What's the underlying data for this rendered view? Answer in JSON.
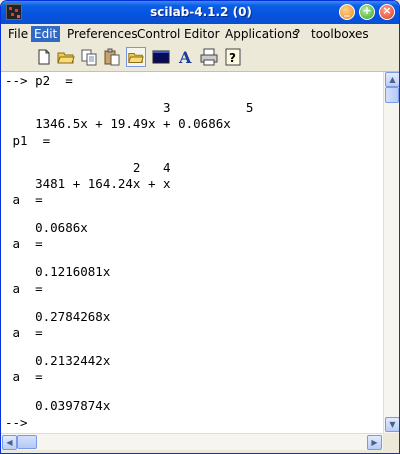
{
  "window": {
    "title": "scilab-4.1.2 (0)"
  },
  "menu": [
    {
      "label": "File"
    },
    {
      "label": "Edit",
      "active": true
    },
    {
      "label": "Preferences"
    },
    {
      "label": "Control"
    },
    {
      "label": "Editor"
    },
    {
      "label": "Applications"
    },
    {
      "label": "?"
    },
    {
      "label": "toolboxes"
    }
  ],
  "toolbar": [
    {
      "icon": "new-file-icon"
    },
    {
      "icon": "open-folder-icon"
    },
    {
      "icon": "copy-icon"
    },
    {
      "icon": "paste-icon"
    },
    {
      "icon": "change-directory-icon"
    },
    {
      "icon": "console-icon"
    },
    {
      "icon": "font-icon"
    },
    {
      "icon": "print-icon"
    },
    {
      "icon": "help-icon"
    }
  ],
  "console": {
    "lines": [
      "--> p2  =",
      "",
      "                     3          5",
      "    1346.5x + 19.49x + 0.0686x",
      " p1  =",
      "",
      "                 2   4",
      "    3481 + 164.24x + x",
      " a  =",
      "",
      "    0.0686x",
      " a  =",
      "",
      "    0.1216081x",
      " a  =",
      "",
      "    0.2784268x",
      " a  =",
      "",
      "    0.2132442x",
      " a  =",
      "",
      "    0.0397874x",
      "-->"
    ]
  },
  "window_buttons": {
    "minimize": "_",
    "maximize": "+",
    "close": "×"
  },
  "scroll_arrows": {
    "up": "▲",
    "down": "▼",
    "left": "◀",
    "right": "▶"
  }
}
